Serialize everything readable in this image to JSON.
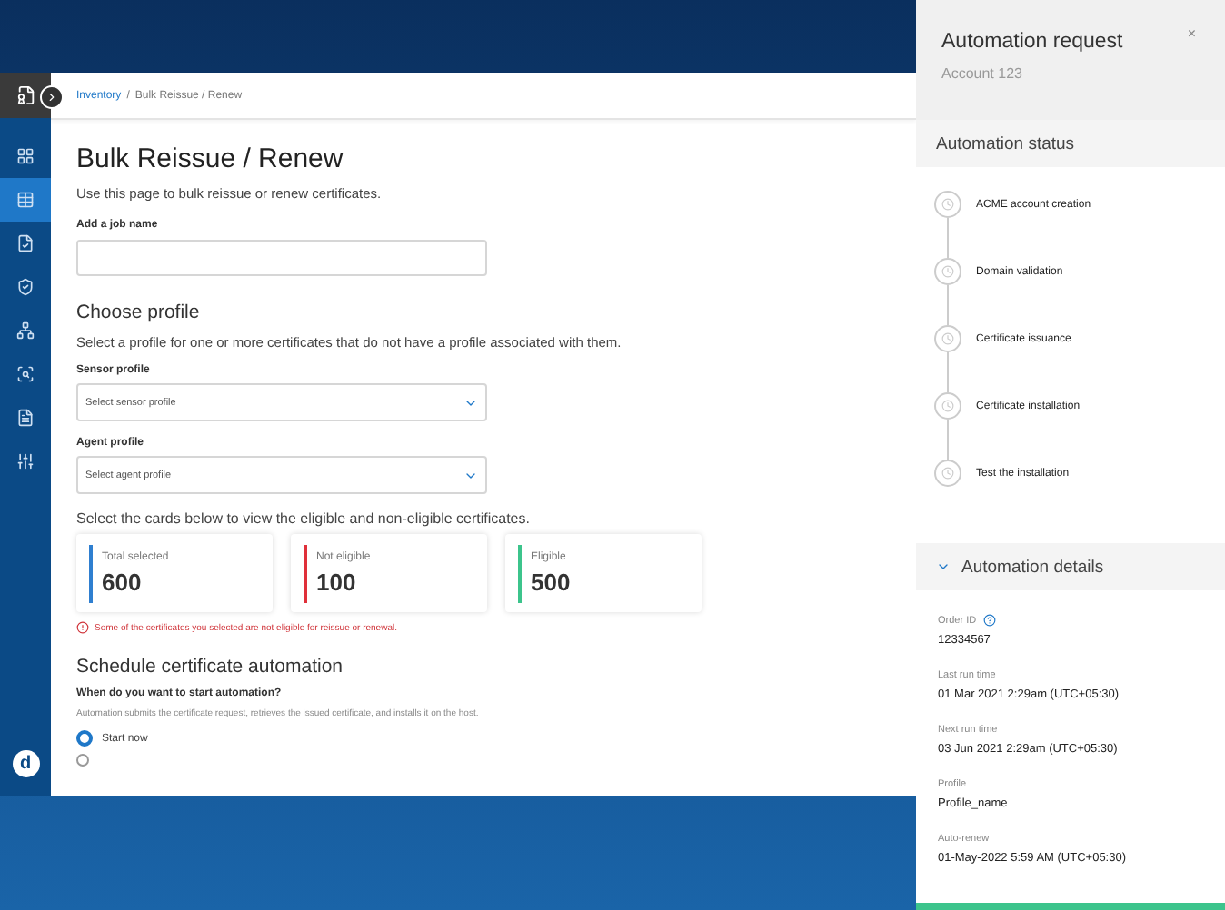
{
  "sidebar": {
    "items": [
      {
        "kind": "grid",
        "selected": false
      },
      {
        "kind": "table",
        "selected": true
      },
      {
        "kind": "report",
        "selected": false
      },
      {
        "kind": "shield",
        "selected": false
      },
      {
        "kind": "network",
        "selected": false
      },
      {
        "kind": "scan",
        "selected": false
      },
      {
        "kind": "document",
        "selected": false
      },
      {
        "kind": "sliders",
        "selected": false
      }
    ],
    "avatar": "d"
  },
  "breadcrumb": {
    "items": [
      "Inventory",
      "Bulk Reissue / Renew"
    ],
    "separator": "/"
  },
  "page": {
    "title": "Bulk Reissue / Renew",
    "subtitle": "Use this page to bulk reissue or renew certificates.",
    "job_name": {
      "label": "Add a job name"
    },
    "profile": {
      "title": "Choose profile",
      "description": "Select a profile for one or more certificates that do not have a profile associated with them.",
      "selects": [
        {
          "label": "Sensor profile",
          "placeholder": "Select sensor profile"
        },
        {
          "label": "Agent profile",
          "placeholder": "Select agent profile"
        }
      ]
    },
    "cards_hint": "Select the cards below to view the eligible and non-eligible certificates.",
    "cards": [
      {
        "label": "Total selected",
        "value": "600",
        "color": "#2f7fd0"
      },
      {
        "label": "Not eligible",
        "value": "100",
        "color": "#e0303a"
      },
      {
        "label": "Eligible",
        "value": "500",
        "color": "#3cc48c"
      }
    ],
    "error": "Some of the certificates you selected are not eligible for reissue or renewal.",
    "schedule": {
      "title": "Schedule certificate automation",
      "question": "When do you want to start automation?",
      "description": "Automation submits the certificate request, retrieves the issued certificate, and installs it on the host.",
      "options": [
        {
          "label": "Start now",
          "selected": true
        },
        {
          "selected": false
        }
      ]
    }
  },
  "panel": {
    "title": "Automation request",
    "subtitle": "Account 123",
    "close": "×",
    "status_title": "Automation status",
    "steps": [
      "ACME account creation",
      "Domain validation",
      "Certificate issuance",
      "Certificate installation",
      "Test the installation"
    ],
    "details_title": "Automation details",
    "details_expanded": true,
    "details": [
      {
        "label": "Order ID",
        "value": "12334567",
        "help": true
      },
      {
        "label": "Last run time",
        "value": "01 Mar 2021 2:29am (UTC+05:30)",
        "help": false
      },
      {
        "label": "Next run time",
        "value": "03 Jun 2021 2:29am (UTC+05:30)",
        "help": false
      },
      {
        "label": "Profile",
        "value": "Profile_name",
        "help": false
      },
      {
        "label": "Auto-renew",
        "value": "01-May-2022 5:59 AM (UTC+05:30)",
        "help": false
      }
    ]
  }
}
